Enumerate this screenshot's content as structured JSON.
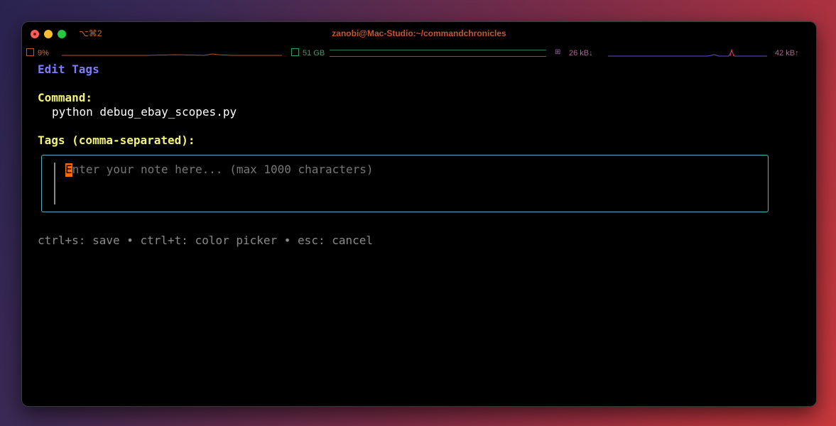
{
  "window": {
    "shortcut": "⌥⌘2",
    "title": "zanobi@Mac-Studio:~/commandchronicles"
  },
  "status": {
    "cpu": "9%",
    "memory": "51 GB",
    "net_down": "26 kB↓",
    "net_up": "42 kB↑",
    "net_icon": "network-icon"
  },
  "screen": {
    "heading": "Edit Tags",
    "command_label": "Command:",
    "command_value": "python debug_ebay_scopes.py",
    "tags_label": "Tags (comma-separated):",
    "tags_input": {
      "value": "",
      "placeholder": "Enter your note here... (max 1000 characters)",
      "cursor_char": "E"
    },
    "help": "ctrl+s: save • ctrl+t: color picker • esc: cancel"
  },
  "colors": {
    "heading": "#7c7cff",
    "label": "#f3f372",
    "input_border": "#4fb4c0",
    "cursor": "#ff6a00"
  }
}
